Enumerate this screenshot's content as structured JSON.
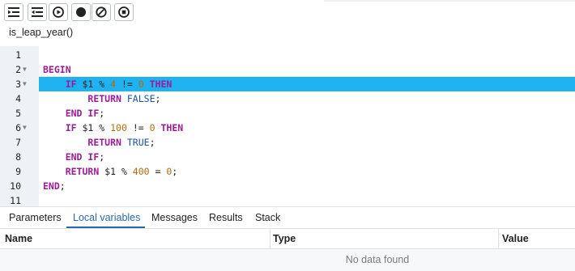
{
  "toolbar": {
    "buttons": [
      {
        "name": "step-into-button",
        "icon": "step-into-icon"
      },
      {
        "name": "step-over-button",
        "icon": "step-over-icon"
      },
      {
        "name": "continue-button",
        "icon": "play-circle-icon"
      },
      {
        "name": "toggle-breakpoint-button",
        "icon": "filled-circle-icon"
      },
      {
        "name": "clear-breakpoints-button",
        "icon": "no-entry-icon"
      },
      {
        "name": "stop-button",
        "icon": "stop-circle-icon"
      }
    ]
  },
  "function_title": "is_leap_year()",
  "editor": {
    "active_line": 3,
    "lines": [
      {
        "n": "1",
        "fold": "",
        "tokens": []
      },
      {
        "n": "2",
        "fold": "▼",
        "tokens": [
          [
            "kw",
            "BEGIN"
          ]
        ]
      },
      {
        "n": "3",
        "fold": "▼",
        "tokens": [
          [
            "sp",
            "    "
          ],
          [
            "kw",
            "IF"
          ],
          [
            "tx",
            " $1 % "
          ],
          [
            "num",
            "4"
          ],
          [
            "tx",
            " != "
          ],
          [
            "num",
            "0"
          ],
          [
            "tx",
            " "
          ],
          [
            "kw",
            "THEN"
          ]
        ]
      },
      {
        "n": "4",
        "fold": "",
        "tokens": [
          [
            "sp",
            "        "
          ],
          [
            "kw",
            "RETURN"
          ],
          [
            "tx",
            " "
          ],
          [
            "bool",
            "FALSE"
          ],
          [
            "tx",
            ";"
          ]
        ]
      },
      {
        "n": "5",
        "fold": "",
        "tokens": [
          [
            "sp",
            "    "
          ],
          [
            "kw",
            "END IF"
          ],
          [
            "tx",
            ";"
          ]
        ]
      },
      {
        "n": "6",
        "fold": "▼",
        "tokens": [
          [
            "sp",
            "    "
          ],
          [
            "kw",
            "IF"
          ],
          [
            "tx",
            " $1 % "
          ],
          [
            "num",
            "100"
          ],
          [
            "tx",
            " != "
          ],
          [
            "num",
            "0"
          ],
          [
            "tx",
            " "
          ],
          [
            "kw",
            "THEN"
          ]
        ]
      },
      {
        "n": "7",
        "fold": "",
        "tokens": [
          [
            "sp",
            "        "
          ],
          [
            "kw",
            "RETURN"
          ],
          [
            "tx",
            " "
          ],
          [
            "bool",
            "TRUE"
          ],
          [
            "tx",
            ";"
          ]
        ]
      },
      {
        "n": "8",
        "fold": "",
        "tokens": [
          [
            "sp",
            "    "
          ],
          [
            "kw",
            "END IF"
          ],
          [
            "tx",
            ";"
          ]
        ]
      },
      {
        "n": "9",
        "fold": "",
        "tokens": [
          [
            "sp",
            "    "
          ],
          [
            "kw",
            "RETURN"
          ],
          [
            "tx",
            " $1 % "
          ],
          [
            "num",
            "400"
          ],
          [
            "tx",
            " = "
          ],
          [
            "num",
            "0"
          ],
          [
            "tx",
            ";"
          ]
        ]
      },
      {
        "n": "10",
        "fold": "",
        "tokens": [
          [
            "kw",
            "END"
          ],
          [
            "tx",
            ";"
          ]
        ]
      },
      {
        "n": "11",
        "fold": "",
        "tokens": []
      }
    ]
  },
  "tabs": [
    {
      "label": "Parameters",
      "active": false
    },
    {
      "label": "Local variables",
      "active": true
    },
    {
      "label": "Messages",
      "active": false
    },
    {
      "label": "Results",
      "active": false
    },
    {
      "label": "Stack",
      "active": false
    }
  ],
  "table": {
    "columns": [
      "Name",
      "Type",
      "Value"
    ],
    "empty_message": "No data found"
  },
  "colors": {
    "highlight": "#1fb2f0",
    "keyword": "#9c1b99",
    "number": "#b5690d",
    "boolean": "#1a52a6",
    "active_tab": "#2a68a3"
  }
}
